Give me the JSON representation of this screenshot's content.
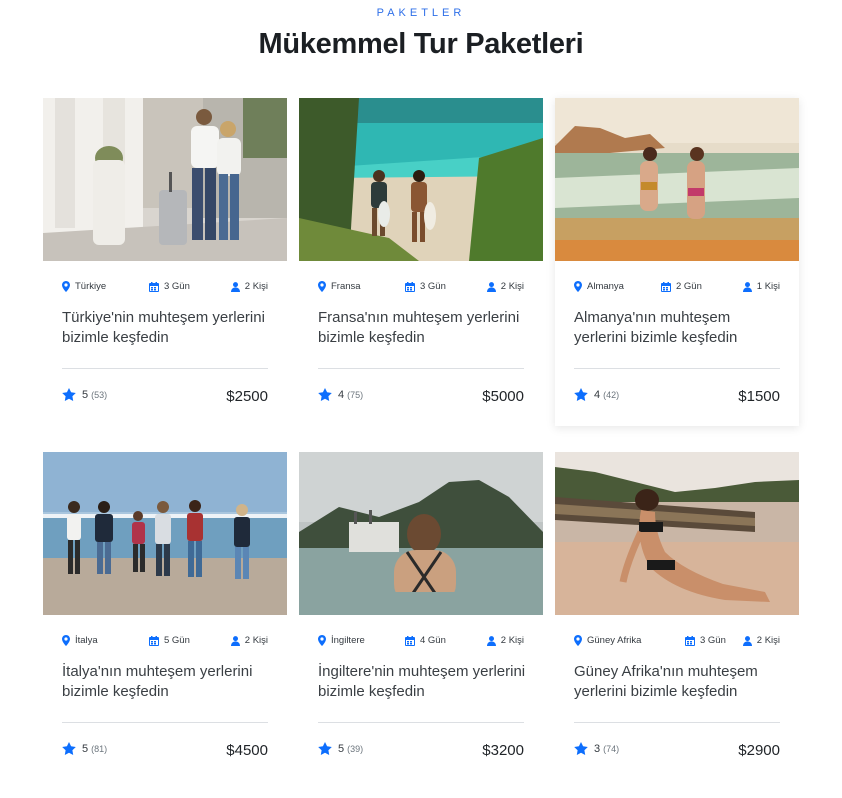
{
  "section": {
    "kicker": "PAKETLER",
    "title": "Mükemmel Tur Paketleri"
  },
  "accent_color": "#0d6efd",
  "icons": {
    "location": "map-marker-icon",
    "duration": "calendar-icon",
    "people": "user-icon",
    "rating": "star-icon"
  },
  "packages": [
    {
      "country": "Türkiye",
      "duration": "3 Gün",
      "people": "2 Kişi",
      "description": "Türkiye'nin muhteşem yerlerini bizimle keşfedin",
      "rating": "5",
      "reviews": "(53)",
      "price": "$2500"
    },
    {
      "country": "Fransa",
      "duration": "3 Gün",
      "people": "2 Kişi",
      "description": "Fransa'nın muhteşem yerlerini bizimle keşfedin",
      "rating": "4",
      "reviews": "(75)",
      "price": "$5000"
    },
    {
      "country": "Almanya",
      "duration": "2 Gün",
      "people": "1 Kişi",
      "description": "Almanya'nın muhteşem yerlerini bizimle keşfedin",
      "rating": "4",
      "reviews": "(42)",
      "price": "$1500"
    },
    {
      "country": "İtalya",
      "duration": "5 Gün",
      "people": "2 Kişi",
      "description": "İtalya'nın muhteşem yerlerini bizimle keşfedin",
      "rating": "5",
      "reviews": "(81)",
      "price": "$4500"
    },
    {
      "country": "İngiltere",
      "duration": "4 Gün",
      "people": "2 Kişi",
      "description": "İngiltere'nin muhteşem yerlerini bizimle keşfedin",
      "rating": "5",
      "reviews": "(39)",
      "price": "$3200"
    },
    {
      "country": "Güney Afrika",
      "duration": "3 Gün",
      "people": "2 Kişi",
      "description": "Güney Afrika'nın muhteşem yerlerini bizimle keşfedin",
      "rating": "3",
      "reviews": "(74)",
      "price": "$2900"
    }
  ]
}
